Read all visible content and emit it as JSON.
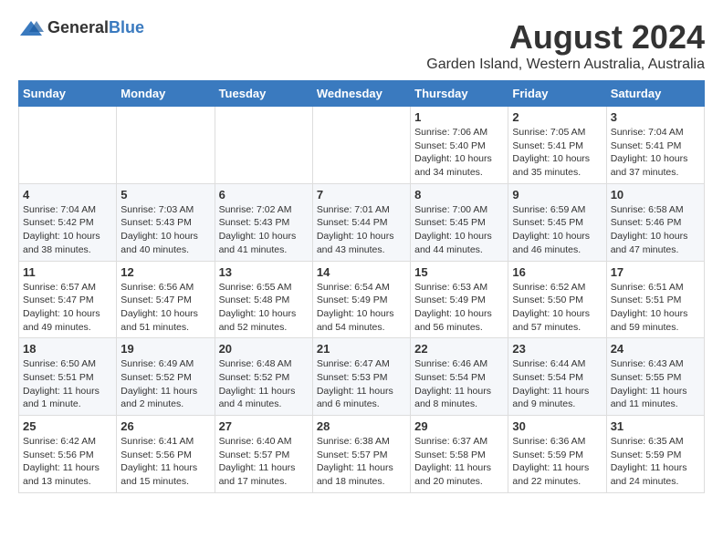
{
  "logo": {
    "text_general": "General",
    "text_blue": "Blue"
  },
  "title": "August 2024",
  "subtitle": "Garden Island, Western Australia, Australia",
  "days_of_week": [
    "Sunday",
    "Monday",
    "Tuesday",
    "Wednesday",
    "Thursday",
    "Friday",
    "Saturday"
  ],
  "weeks": [
    [
      {
        "day": "",
        "content": ""
      },
      {
        "day": "",
        "content": ""
      },
      {
        "day": "",
        "content": ""
      },
      {
        "day": "",
        "content": ""
      },
      {
        "day": "1",
        "content": "Sunrise: 7:06 AM\nSunset: 5:40 PM\nDaylight: 10 hours\nand 34 minutes."
      },
      {
        "day": "2",
        "content": "Sunrise: 7:05 AM\nSunset: 5:41 PM\nDaylight: 10 hours\nand 35 minutes."
      },
      {
        "day": "3",
        "content": "Sunrise: 7:04 AM\nSunset: 5:41 PM\nDaylight: 10 hours\nand 37 minutes."
      }
    ],
    [
      {
        "day": "4",
        "content": "Sunrise: 7:04 AM\nSunset: 5:42 PM\nDaylight: 10 hours\nand 38 minutes."
      },
      {
        "day": "5",
        "content": "Sunrise: 7:03 AM\nSunset: 5:43 PM\nDaylight: 10 hours\nand 40 minutes."
      },
      {
        "day": "6",
        "content": "Sunrise: 7:02 AM\nSunset: 5:43 PM\nDaylight: 10 hours\nand 41 minutes."
      },
      {
        "day": "7",
        "content": "Sunrise: 7:01 AM\nSunset: 5:44 PM\nDaylight: 10 hours\nand 43 minutes."
      },
      {
        "day": "8",
        "content": "Sunrise: 7:00 AM\nSunset: 5:45 PM\nDaylight: 10 hours\nand 44 minutes."
      },
      {
        "day": "9",
        "content": "Sunrise: 6:59 AM\nSunset: 5:45 PM\nDaylight: 10 hours\nand 46 minutes."
      },
      {
        "day": "10",
        "content": "Sunrise: 6:58 AM\nSunset: 5:46 PM\nDaylight: 10 hours\nand 47 minutes."
      }
    ],
    [
      {
        "day": "11",
        "content": "Sunrise: 6:57 AM\nSunset: 5:47 PM\nDaylight: 10 hours\nand 49 minutes."
      },
      {
        "day": "12",
        "content": "Sunrise: 6:56 AM\nSunset: 5:47 PM\nDaylight: 10 hours\nand 51 minutes."
      },
      {
        "day": "13",
        "content": "Sunrise: 6:55 AM\nSunset: 5:48 PM\nDaylight: 10 hours\nand 52 minutes."
      },
      {
        "day": "14",
        "content": "Sunrise: 6:54 AM\nSunset: 5:49 PM\nDaylight: 10 hours\nand 54 minutes."
      },
      {
        "day": "15",
        "content": "Sunrise: 6:53 AM\nSunset: 5:49 PM\nDaylight: 10 hours\nand 56 minutes."
      },
      {
        "day": "16",
        "content": "Sunrise: 6:52 AM\nSunset: 5:50 PM\nDaylight: 10 hours\nand 57 minutes."
      },
      {
        "day": "17",
        "content": "Sunrise: 6:51 AM\nSunset: 5:51 PM\nDaylight: 10 hours\nand 59 minutes."
      }
    ],
    [
      {
        "day": "18",
        "content": "Sunrise: 6:50 AM\nSunset: 5:51 PM\nDaylight: 11 hours\nand 1 minute."
      },
      {
        "day": "19",
        "content": "Sunrise: 6:49 AM\nSunset: 5:52 PM\nDaylight: 11 hours\nand 2 minutes."
      },
      {
        "day": "20",
        "content": "Sunrise: 6:48 AM\nSunset: 5:52 PM\nDaylight: 11 hours\nand 4 minutes."
      },
      {
        "day": "21",
        "content": "Sunrise: 6:47 AM\nSunset: 5:53 PM\nDaylight: 11 hours\nand 6 minutes."
      },
      {
        "day": "22",
        "content": "Sunrise: 6:46 AM\nSunset: 5:54 PM\nDaylight: 11 hours\nand 8 minutes."
      },
      {
        "day": "23",
        "content": "Sunrise: 6:44 AM\nSunset: 5:54 PM\nDaylight: 11 hours\nand 9 minutes."
      },
      {
        "day": "24",
        "content": "Sunrise: 6:43 AM\nSunset: 5:55 PM\nDaylight: 11 hours\nand 11 minutes."
      }
    ],
    [
      {
        "day": "25",
        "content": "Sunrise: 6:42 AM\nSunset: 5:56 PM\nDaylight: 11 hours\nand 13 minutes."
      },
      {
        "day": "26",
        "content": "Sunrise: 6:41 AM\nSunset: 5:56 PM\nDaylight: 11 hours\nand 15 minutes."
      },
      {
        "day": "27",
        "content": "Sunrise: 6:40 AM\nSunset: 5:57 PM\nDaylight: 11 hours\nand 17 minutes."
      },
      {
        "day": "28",
        "content": "Sunrise: 6:38 AM\nSunset: 5:57 PM\nDaylight: 11 hours\nand 18 minutes."
      },
      {
        "day": "29",
        "content": "Sunrise: 6:37 AM\nSunset: 5:58 PM\nDaylight: 11 hours\nand 20 minutes."
      },
      {
        "day": "30",
        "content": "Sunrise: 6:36 AM\nSunset: 5:59 PM\nDaylight: 11 hours\nand 22 minutes."
      },
      {
        "day": "31",
        "content": "Sunrise: 6:35 AM\nSunset: 5:59 PM\nDaylight: 11 hours\nand 24 minutes."
      }
    ]
  ]
}
